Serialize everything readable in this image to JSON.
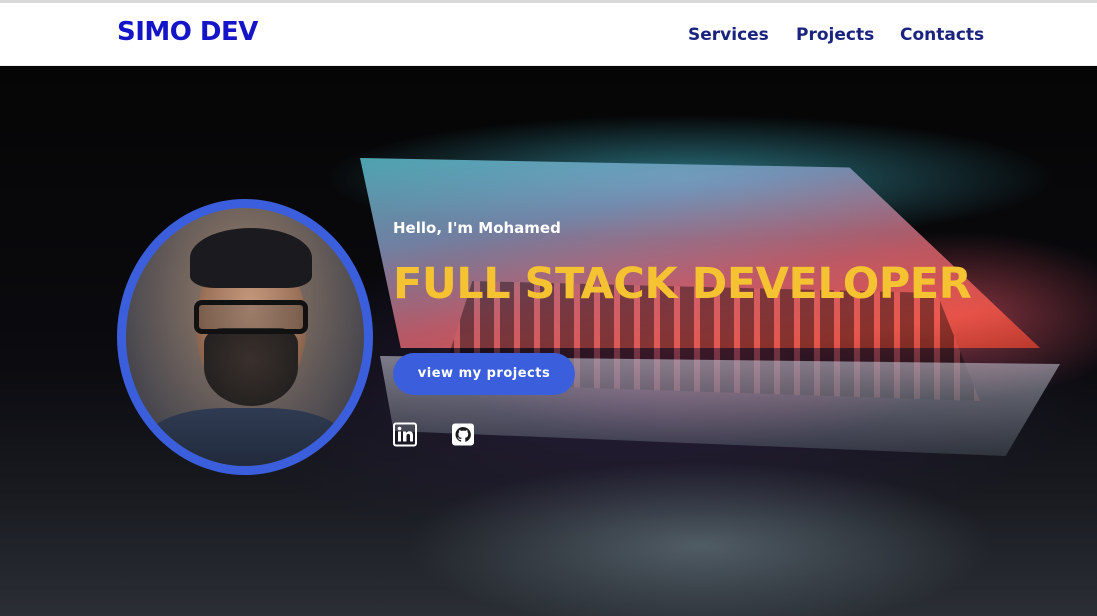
{
  "navbar": {
    "brand": "SIMO DEV",
    "links": [
      "Services",
      "Projects",
      "Contacts"
    ]
  },
  "hero": {
    "greeting": "Hello, I'm Mohamed",
    "headline": "FULL STACK DEVELOPER",
    "cta_label": "view my projects",
    "social": [
      {
        "icon": "linkedin-icon"
      },
      {
        "icon": "github-icon"
      }
    ]
  },
  "colors": {
    "brand_blue": "#1414c8",
    "nav_text": "#1a237e",
    "accent_blue": "#3b5fdc",
    "headline_yellow": "#f5c232"
  }
}
